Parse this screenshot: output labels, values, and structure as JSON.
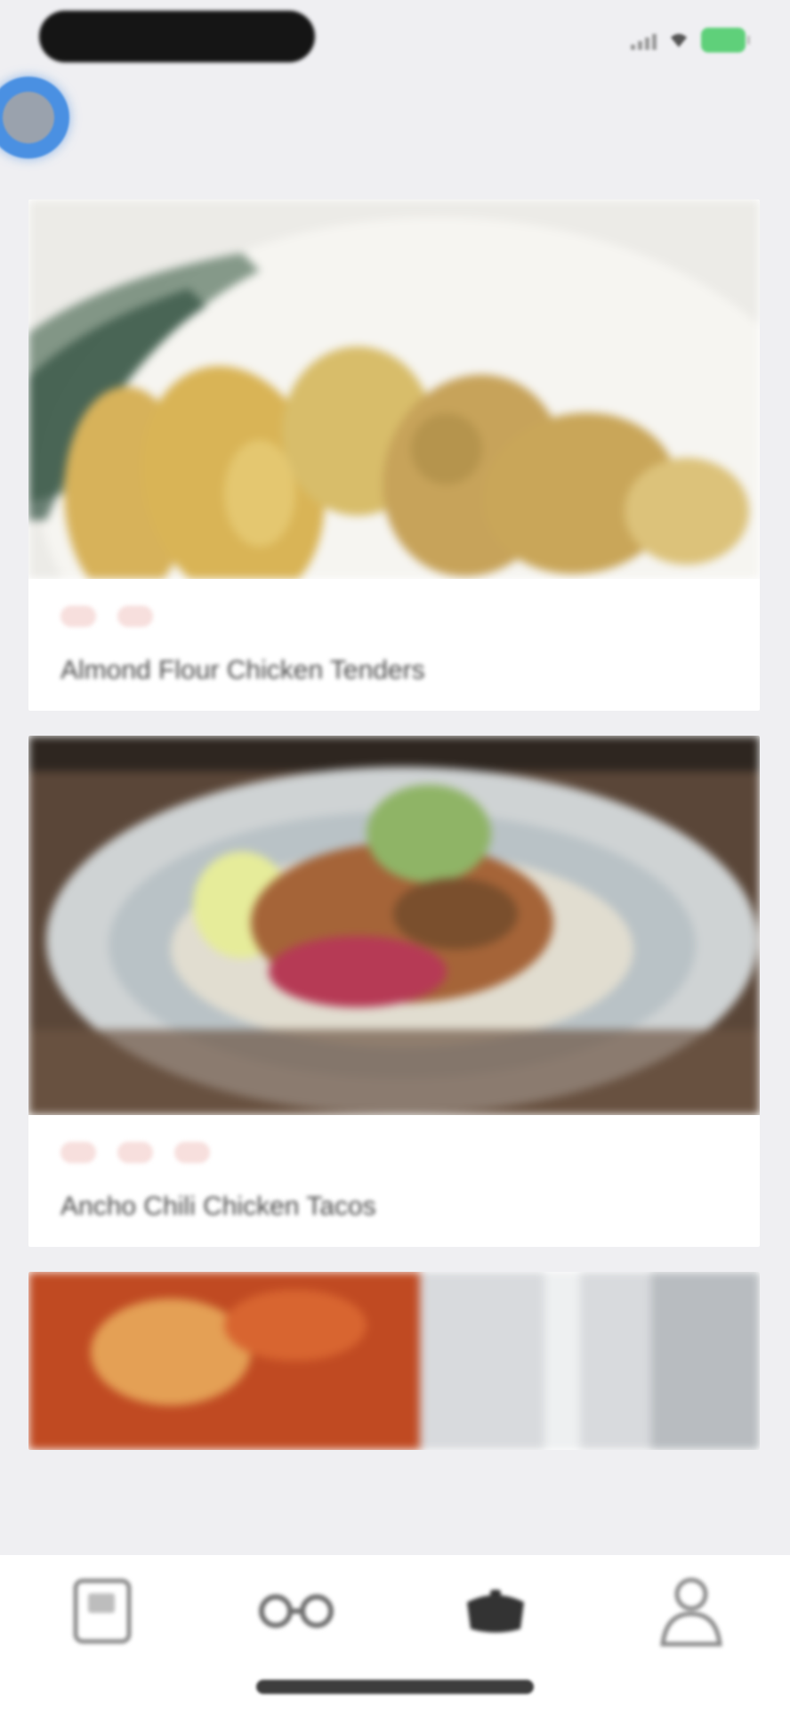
{
  "status_bar": {
    "time_pill_text": "",
    "battery_color": "#5fd07a"
  },
  "floating_avatar": {
    "icon": "assistive-touch-icon",
    "color": "#4a90e2"
  },
  "feed": {
    "cards": [
      {
        "image": "chicken-tenders-photo",
        "tags": [
          "",
          ""
        ],
        "title": "Almond Flour Chicken Tenders"
      },
      {
        "image": "chicken-tacos-photo",
        "tags": [
          "",
          "",
          ""
        ],
        "title": "Ancho Chili Chicken Tacos"
      },
      {
        "image": "tomato-dish-photo",
        "tags": [],
        "title": ""
      }
    ]
  },
  "bottom_nav": {
    "items": [
      {
        "icon": "recipe-book-icon"
      },
      {
        "icon": "meal-plan-icon"
      },
      {
        "icon": "cooking-pot-icon"
      },
      {
        "icon": "profile-icon"
      }
    ]
  },
  "colors": {
    "tag_bg": "#f7dfdd",
    "tag_text": "#c87a72",
    "background": "#efeff2"
  }
}
